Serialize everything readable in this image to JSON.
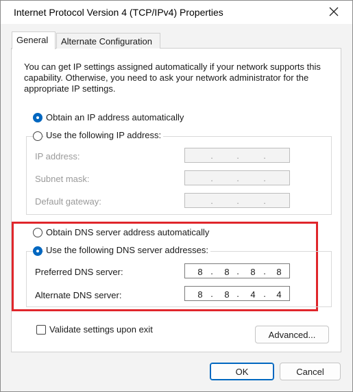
{
  "window": {
    "title": "Internet Protocol Version 4 (TCP/IPv4) Properties"
  },
  "tabs": [
    {
      "label": "General",
      "selected": true
    },
    {
      "label": "Alternate Configuration",
      "selected": false
    }
  ],
  "description": "You can get IP settings assigned automatically if your network supports this capability. Otherwise, you need to ask your network administrator for the appropriate IP settings.",
  "ip": {
    "auto_label": "Obtain an IP address automatically",
    "manual_label": "Use the following IP address:",
    "auto_selected": true,
    "fields": [
      {
        "label": "IP address:",
        "value": [
          "",
          "",
          "",
          ""
        ]
      },
      {
        "label": "Subnet mask:",
        "value": [
          "",
          "",
          "",
          ""
        ]
      },
      {
        "label": "Default gateway:",
        "value": [
          "",
          "",
          "",
          ""
        ]
      }
    ]
  },
  "dns": {
    "auto_label": "Obtain DNS server address automatically",
    "manual_label": "Use the following DNS server addresses:",
    "manual_selected": true,
    "preferred": {
      "label": "Preferred DNS server:",
      "octets": [
        "8",
        "8",
        "8",
        "8"
      ]
    },
    "alternate": {
      "label": "Alternate DNS server:",
      "octets": [
        "8",
        "8",
        "4",
        "4"
      ]
    }
  },
  "validate": {
    "label": "Validate settings upon exit",
    "checked": false
  },
  "buttons": {
    "advanced": "Advanced...",
    "ok": "OK",
    "cancel": "Cancel"
  },
  "colors": {
    "accent": "#0067c0",
    "highlight_box": "#e0262b"
  },
  "icons": {
    "close": "close-icon"
  }
}
